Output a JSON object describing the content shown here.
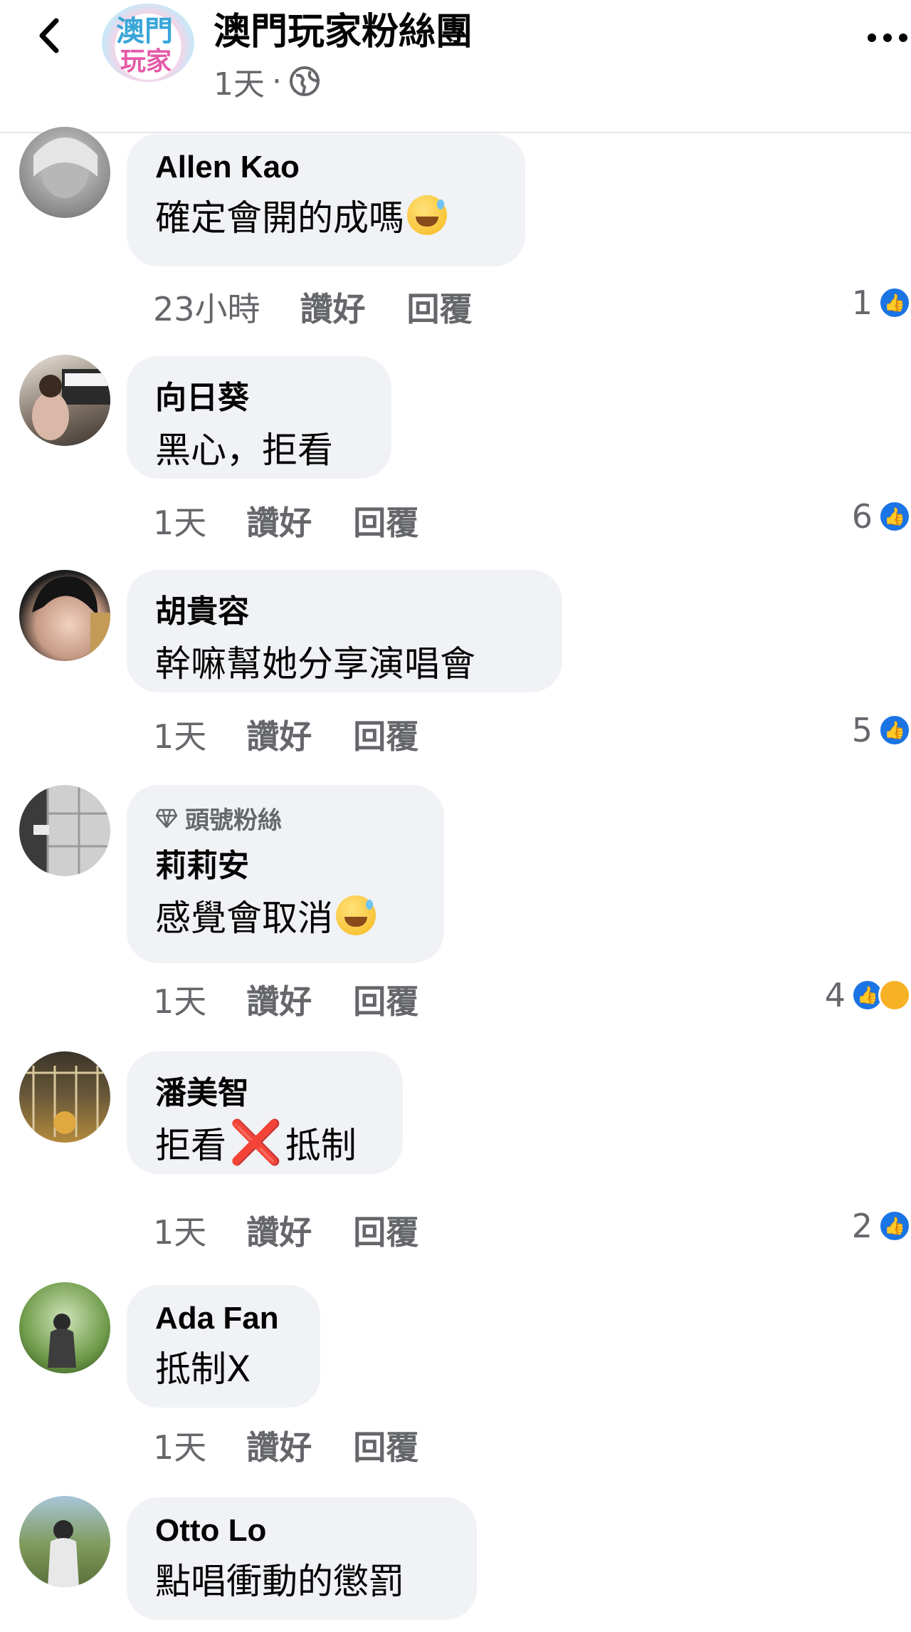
{
  "header": {
    "back_icon": "chevron-left-icon",
    "logo_text_top": "澳門",
    "logo_text_bottom": "玩家",
    "group_name": "澳門玩家粉絲團",
    "time": "1天",
    "separator": "·",
    "privacy_icon": "globe-icon",
    "more_icon": "more-dots-icon"
  },
  "comments": [
    {
      "author": "Allen Kao",
      "text": "確定會開的成嗎",
      "emoji": "grinning-sweat-emoji",
      "time": "23小時",
      "like": "讚好",
      "reply": "回覆",
      "count": "1",
      "reactions": [
        "like"
      ]
    },
    {
      "author": "向日葵",
      "text": "黑心，拒看",
      "time": "1天",
      "like": "讚好",
      "reply": "回覆",
      "count": "6",
      "reactions": [
        "like"
      ]
    },
    {
      "author": "胡貴容",
      "text": "幹嘛幫她分享演唱會",
      "time": "1天",
      "like": "讚好",
      "reply": "回覆",
      "count": "5",
      "reactions": [
        "like"
      ]
    },
    {
      "badge": "頭號粉絲",
      "author": "莉莉安",
      "text": "感覺會取消",
      "emoji": "grinning-sweat-emoji",
      "time": "1天",
      "like": "讚好",
      "reply": "回覆",
      "count": "4",
      "reactions": [
        "like",
        "haha"
      ]
    },
    {
      "author": "潘美智",
      "text_before": "拒看",
      "text_mark": "❌",
      "text_after": "抵制",
      "time": "1天",
      "like": "讚好",
      "reply": "回覆",
      "count": "2",
      "reactions": [
        "like"
      ]
    },
    {
      "author": "Ada Fan",
      "text": "抵制X",
      "time": "1天",
      "like": "讚好",
      "reply": "回覆"
    },
    {
      "author": "Otto Lo",
      "text": "點唱衝動的懲罰"
    }
  ],
  "colors": {
    "bubble": "#f0f2f5",
    "secondary_text": "#65676b",
    "like_blue": "#1b74e4",
    "haha_yellow": "#f7b125",
    "x_red": "#e0152a"
  }
}
